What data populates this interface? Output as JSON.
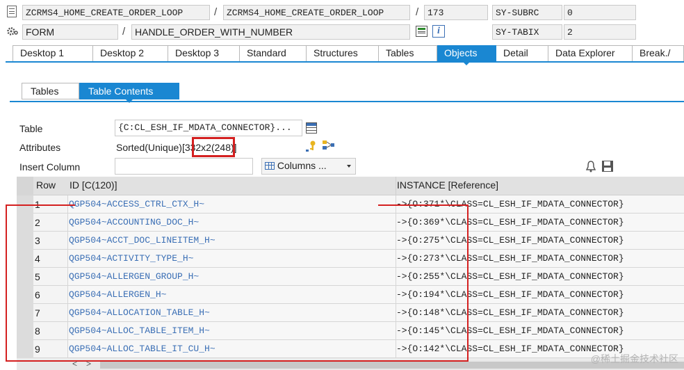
{
  "header": {
    "program": "ZCRMS4_HOME_CREATE_ORDER_LOOP",
    "include": "ZCRMS4_HOME_CREATE_ORDER_LOOP",
    "line": "173",
    "sy_subrc_label": "SY-SUBRC",
    "sy_subrc_value": "0",
    "event_type": "FORM",
    "event_name": "HANDLE_ORDER_WITH_NUMBER",
    "sy_tabix_label": "SY-TABIX",
    "sy_tabix_value": "2",
    "slash": "/"
  },
  "tabs": [
    "Desktop 1",
    "Desktop 2",
    "Desktop 3",
    "Standard",
    "Structures",
    "Tables",
    "Objects",
    "Detail",
    "Data Explorer",
    "Break./"
  ],
  "subtabs": [
    "Tables",
    "Table Contents"
  ],
  "form": {
    "table_label": "Table",
    "table_value": "{C:CL_ESH_IF_MDATA_CONNECTOR}...",
    "attributes_label": "Attributes",
    "attributes_value": "Sorted(Unique)[332x2(248)]",
    "insert_column_label": "Insert Column",
    "columns_button": "Columns ..."
  },
  "table": {
    "headers": [
      "Row",
      "ID [C(120)]",
      "INSTANCE [Reference]"
    ],
    "rows": [
      {
        "row": "1",
        "id": "QGP504~ACCESS_CTRL_CTX_H~",
        "instance": "->{O:371*\\CLASS=CL_ESH_IF_MDATA_CONNECTOR}"
      },
      {
        "row": "2",
        "id": "QGP504~ACCOUNTING_DOC_H~",
        "instance": "->{O:369*\\CLASS=CL_ESH_IF_MDATA_CONNECTOR}"
      },
      {
        "row": "3",
        "id": "QGP504~ACCT_DOC_LINEITEM_H~",
        "instance": "->{O:275*\\CLASS=CL_ESH_IF_MDATA_CONNECTOR}"
      },
      {
        "row": "4",
        "id": "QGP504~ACTIVITY_TYPE_H~",
        "instance": "->{O:273*\\CLASS=CL_ESH_IF_MDATA_CONNECTOR}"
      },
      {
        "row": "5",
        "id": "QGP504~ALLERGEN_GROUP_H~",
        "instance": "->{O:255*\\CLASS=CL_ESH_IF_MDATA_CONNECTOR}"
      },
      {
        "row": "6",
        "id": "QGP504~ALLERGEN_H~",
        "instance": "->{O:194*\\CLASS=CL_ESH_IF_MDATA_CONNECTOR}"
      },
      {
        "row": "7",
        "id": "QGP504~ALLOCATION_TABLE_H~",
        "instance": "->{O:148*\\CLASS=CL_ESH_IF_MDATA_CONNECTOR}"
      },
      {
        "row": "8",
        "id": "QGP504~ALLOC_TABLE_ITEM_H~",
        "instance": "->{O:145*\\CLASS=CL_ESH_IF_MDATA_CONNECTOR}"
      },
      {
        "row": "9",
        "id": "QGP504~ALLOC_TABLE_IT_CU_H~",
        "instance": "->{O:142*\\CLASS=CL_ESH_IF_MDATA_CONNECTOR}"
      }
    ]
  },
  "watermark": "@稀土掘金技术社区",
  "colors": {
    "accent": "#1a87d2",
    "highlight": "#d42020"
  }
}
